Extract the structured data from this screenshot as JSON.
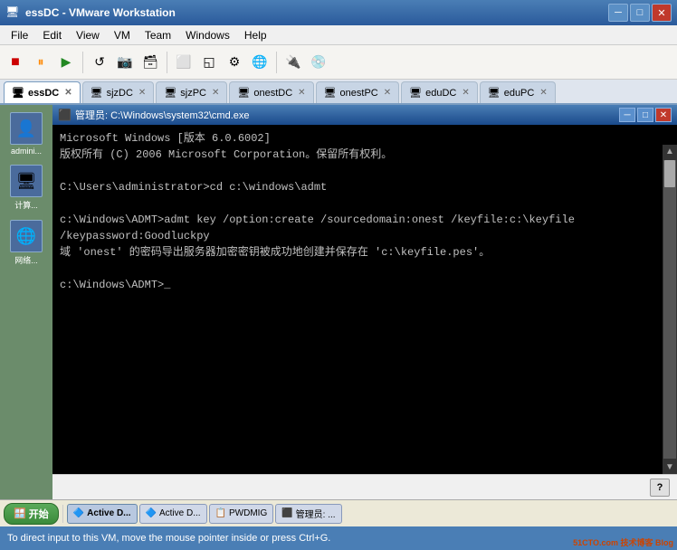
{
  "app": {
    "title": "essDC - VMware Workstation",
    "icon": "🖥"
  },
  "title_bar": {
    "text": "essDC - VMware Workstation",
    "minimize": "─",
    "maximize": "□",
    "close": "✕"
  },
  "menu": {
    "items": [
      "File",
      "Edit",
      "View",
      "VM",
      "Team",
      "Windows",
      "Help"
    ]
  },
  "tabs": [
    {
      "label": "essDC",
      "active": true
    },
    {
      "label": "sjzDC",
      "active": false
    },
    {
      "label": "sjzPC",
      "active": false
    },
    {
      "label": "onestDC",
      "active": false
    },
    {
      "label": "onestPC",
      "active": false
    },
    {
      "label": "eduDC",
      "active": false
    },
    {
      "label": "eduPC",
      "active": false
    }
  ],
  "sidebar": {
    "items": [
      {
        "label": "admini...",
        "icon": "👤"
      },
      {
        "label": "计算...",
        "icon": "🖥"
      },
      {
        "label": "网络...",
        "icon": "🌐"
      }
    ]
  },
  "cmd": {
    "title": "管理员: C:\\Windows\\system32\\cmd.exe",
    "content": [
      "Microsoft Windows [版本 6.0.6002]",
      "版权所有 (C) 2006 Microsoft Corporation。保留所有权利。",
      "",
      "C:\\Users\\administrator>cd c:\\windows\\admt",
      "",
      "c:\\Windows\\ADMT>admt key /option:create /sourcedomain:onest /keyfile:c:\\keyfile",
      "/keypassword:Goodluckpy",
      "域 'onest' 的密码导出服务器加密密钥被成功地创建并保存在 'c:\\keyfile.pes'。",
      "",
      "c:\\Windows\\ADMT>_"
    ],
    "minimize": "─",
    "maximize": "□",
    "close": "✕"
  },
  "taskbar": {
    "start_label": "开始",
    "items": [
      {
        "label": "Active D...",
        "active": true,
        "icon": "🔷"
      },
      {
        "label": "Active D...",
        "active": false,
        "icon": "🔷"
      },
      {
        "label": "PWDMIG",
        "active": false,
        "icon": "📋"
      },
      {
        "label": "管理员: ...",
        "active": false,
        "icon": "⬛"
      }
    ]
  },
  "bottom_hint": "To direct input to this VM, move the mouse pointer inside or press Ctrl+G.",
  "watermark": "51CTO.com 技术博客 Blog"
}
